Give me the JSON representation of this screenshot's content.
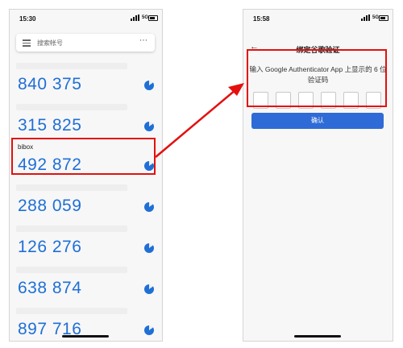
{
  "left_phone": {
    "time": "15:30",
    "network": "5G",
    "search_placeholder": "搜索帐号",
    "more_label": "⋯",
    "entries": [
      {
        "label": "",
        "code": "840 375"
      },
      {
        "label": "",
        "code": "315 825"
      },
      {
        "label": "bibox",
        "code": "492 872"
      },
      {
        "label": "",
        "code": "288 059"
      },
      {
        "label": "",
        "code": "126 276"
      },
      {
        "label": "",
        "code": "638 874"
      },
      {
        "label": "",
        "code": "897 716"
      }
    ]
  },
  "right_phone": {
    "time": "15:58",
    "network": "5G",
    "back_label": "←",
    "title": "绑定谷歌验证",
    "description": "输入 Google Authenticator App 上显示的 6 位验证码",
    "confirm_label": "确认"
  },
  "colors": {
    "code_blue": "#1f6fd6",
    "highlight_red": "#e4100f",
    "button_blue": "#2f6bd6"
  }
}
